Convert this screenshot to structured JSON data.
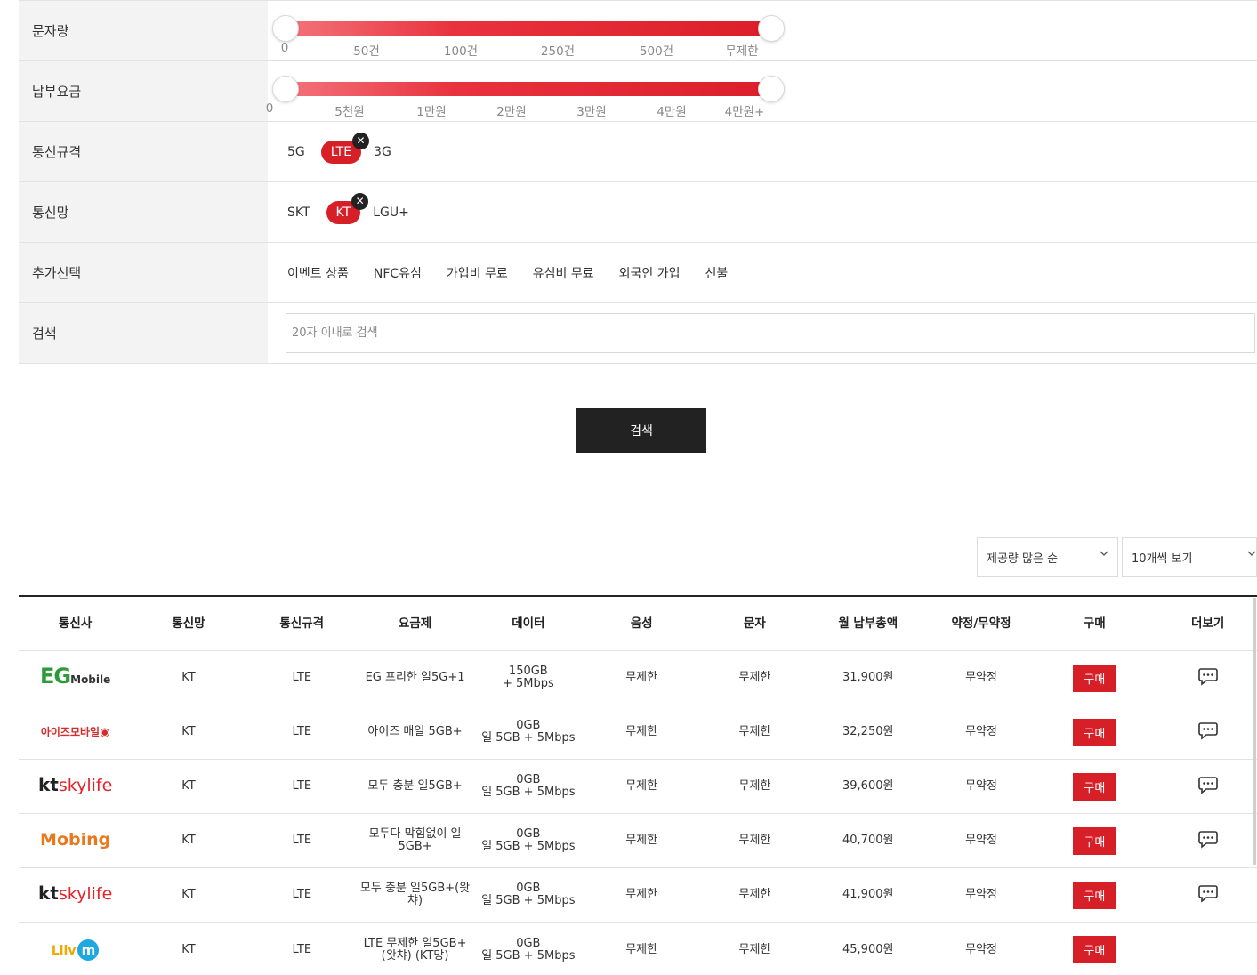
{
  "filters": {
    "texts": {
      "label": "문자량",
      "ticks": [
        "0",
        "50건",
        "100건",
        "250건",
        "500건",
        "무제한"
      ]
    },
    "fee": {
      "label": "납부요금",
      "ticks": [
        "0",
        "5천원",
        "1만원",
        "2만원",
        "3만원",
        "4만원",
        "4만원+"
      ]
    },
    "spec": {
      "label": "통신규격",
      "options": [
        "5G",
        "LTE",
        "3G"
      ],
      "selected": "LTE",
      "remove_glyph": "✕"
    },
    "network": {
      "label": "통신망",
      "options": [
        "SKT",
        "KT",
        "LGU+"
      ],
      "selected": "KT",
      "remove_glyph": "✕"
    },
    "extra": {
      "label": "추가선택",
      "options": [
        "이벤트 상품",
        "NFC유심",
        "가입비 무료",
        "유심비 무료",
        "외국인 가입",
        "선불"
      ]
    },
    "search": {
      "label": "검색",
      "placeholder": "20자 이내로 검색"
    }
  },
  "search_button": "검색",
  "sort": {
    "order": "제공량 많은 순",
    "per_page": "10개씩 보기"
  },
  "colors": {
    "accent": "#d71f28",
    "dark": "#222222"
  },
  "table": {
    "headers": [
      "통신사",
      "통신망",
      "통신규격",
      "요금제",
      "데이터",
      "음성",
      "문자",
      "월 납부총액",
      "약정/무약정",
      "구매",
      "더보기"
    ],
    "rows": [
      {
        "carrier": "EG Mobile",
        "network": "KT",
        "spec": "LTE",
        "plan": "EG 프리한 일5G+1",
        "data1": "150GB",
        "data2": "+ 5Mbps",
        "voice": "무제한",
        "sms": "무제한",
        "price": "31,900원",
        "contract": "무약정",
        "buy": "구매",
        "more_icon": "chat-bubbles-icon"
      },
      {
        "carrier": "아이즈모바일",
        "network": "KT",
        "spec": "LTE",
        "plan": "아이즈 매일 5GB+",
        "data1": "0GB",
        "data2": "일 5GB + 5Mbps",
        "voice": "무제한",
        "sms": "무제한",
        "price": "32,250원",
        "contract": "무약정",
        "buy": "구매",
        "more_icon": "chat-bubbles-icon"
      },
      {
        "carrier": "kt skylife",
        "network": "KT",
        "spec": "LTE",
        "plan": "모두 충분 일5GB+",
        "data1": "0GB",
        "data2": "일 5GB + 5Mbps",
        "voice": "무제한",
        "sms": "무제한",
        "price": "39,600원",
        "contract": "무약정",
        "buy": "구매",
        "more_icon": "chat-bubbles-icon"
      },
      {
        "carrier": "Mobing",
        "network": "KT",
        "spec": "LTE",
        "plan": "모두다 막힘없이 일 5GB+",
        "data1": "0GB",
        "data2": "일 5GB + 5Mbps",
        "voice": "무제한",
        "sms": "무제한",
        "price": "40,700원",
        "contract": "무약정",
        "buy": "구매",
        "more_icon": "chat-bubbles-icon"
      },
      {
        "carrier": "kt skylife",
        "network": "KT",
        "spec": "LTE",
        "plan": "모두 충분 일5GB+(왓챠)",
        "data1": "0GB",
        "data2": "일 5GB + 5Mbps",
        "voice": "무제한",
        "sms": "무제한",
        "price": "41,900원",
        "contract": "무약정",
        "buy": "구매",
        "more_icon": "chat-bubbles-icon"
      },
      {
        "carrier": "Liiv m",
        "network": "KT",
        "spec": "LTE",
        "plan": "LTE 무제한 일5GB+ (왓챠) (KT망)",
        "data1": "0GB",
        "data2": "일 5GB + 5Mbps",
        "voice": "무제한",
        "sms": "무제한",
        "price": "45,900원",
        "contract": "무약정",
        "buy": "구매",
        "more_icon": ""
      }
    ]
  }
}
